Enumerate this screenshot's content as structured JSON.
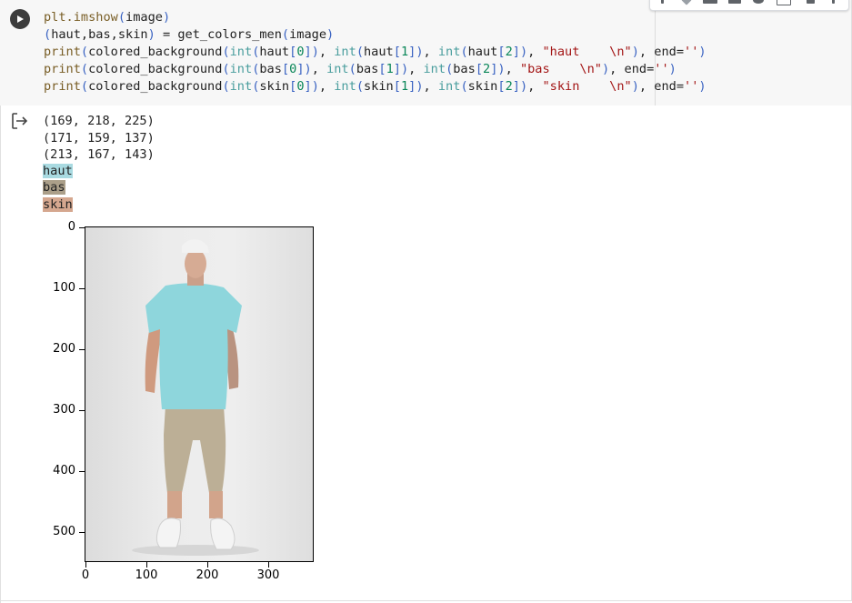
{
  "cell": {
    "code_lines": [
      [
        {
          "t": "plt.imshow",
          "c": "fn"
        },
        {
          "t": "(",
          "c": "pp"
        },
        {
          "t": "image",
          "c": ""
        },
        {
          "t": ")",
          "c": "pp"
        }
      ],
      [
        {
          "t": "(",
          "c": "pp"
        },
        {
          "t": "haut,bas,skin",
          "c": ""
        },
        {
          "t": ")",
          "c": "pp"
        },
        {
          "t": " = get_colors_men",
          "c": ""
        },
        {
          "t": "(",
          "c": "pp"
        },
        {
          "t": "image",
          "c": ""
        },
        {
          "t": ")",
          "c": "pp"
        }
      ],
      [
        {
          "t": "print",
          "c": "fn"
        },
        {
          "t": "(",
          "c": "pp"
        },
        {
          "t": "colored_background",
          "c": ""
        },
        {
          "t": "(",
          "c": "pp"
        },
        {
          "t": "int",
          "c": "bi"
        },
        {
          "t": "(",
          "c": "pp"
        },
        {
          "t": "haut",
          "c": ""
        },
        {
          "t": "[",
          "c": "pp"
        },
        {
          "t": "0",
          "c": "num"
        },
        {
          "t": "]",
          "c": "pp"
        },
        {
          "t": ")",
          "c": "pp"
        },
        {
          "t": ", ",
          "c": ""
        },
        {
          "t": "int",
          "c": "bi"
        },
        {
          "t": "(",
          "c": "pp"
        },
        {
          "t": "haut",
          "c": ""
        },
        {
          "t": "[",
          "c": "pp"
        },
        {
          "t": "1",
          "c": "num"
        },
        {
          "t": "]",
          "c": "pp"
        },
        {
          "t": ")",
          "c": "pp"
        },
        {
          "t": ", ",
          "c": ""
        },
        {
          "t": "int",
          "c": "bi"
        },
        {
          "t": "(",
          "c": "pp"
        },
        {
          "t": "haut",
          "c": ""
        },
        {
          "t": "[",
          "c": "pp"
        },
        {
          "t": "2",
          "c": "num"
        },
        {
          "t": "]",
          "c": "pp"
        },
        {
          "t": ")",
          "c": "pp"
        },
        {
          "t": ", ",
          "c": ""
        },
        {
          "t": "\"haut    \\n\"",
          "c": "str"
        },
        {
          "t": ")",
          "c": "pp"
        },
        {
          "t": ", end=",
          "c": ""
        },
        {
          "t": "''",
          "c": "str"
        },
        {
          "t": ")",
          "c": "pp"
        }
      ],
      [
        {
          "t": "print",
          "c": "fn"
        },
        {
          "t": "(",
          "c": "pp"
        },
        {
          "t": "colored_background",
          "c": ""
        },
        {
          "t": "(",
          "c": "pp"
        },
        {
          "t": "int",
          "c": "bi"
        },
        {
          "t": "(",
          "c": "pp"
        },
        {
          "t": "bas",
          "c": ""
        },
        {
          "t": "[",
          "c": "pp"
        },
        {
          "t": "0",
          "c": "num"
        },
        {
          "t": "]",
          "c": "pp"
        },
        {
          "t": ")",
          "c": "pp"
        },
        {
          "t": ", ",
          "c": ""
        },
        {
          "t": "int",
          "c": "bi"
        },
        {
          "t": "(",
          "c": "pp"
        },
        {
          "t": "bas",
          "c": ""
        },
        {
          "t": "[",
          "c": "pp"
        },
        {
          "t": "1",
          "c": "num"
        },
        {
          "t": "]",
          "c": "pp"
        },
        {
          "t": ")",
          "c": "pp"
        },
        {
          "t": ", ",
          "c": ""
        },
        {
          "t": "int",
          "c": "bi"
        },
        {
          "t": "(",
          "c": "pp"
        },
        {
          "t": "bas",
          "c": ""
        },
        {
          "t": "[",
          "c": "pp"
        },
        {
          "t": "2",
          "c": "num"
        },
        {
          "t": "]",
          "c": "pp"
        },
        {
          "t": ")",
          "c": "pp"
        },
        {
          "t": ", ",
          "c": ""
        },
        {
          "t": "\"bas    \\n\"",
          "c": "str"
        },
        {
          "t": ")",
          "c": "pp"
        },
        {
          "t": ", end=",
          "c": ""
        },
        {
          "t": "''",
          "c": "str"
        },
        {
          "t": ")",
          "c": "pp"
        }
      ],
      [
        {
          "t": "print",
          "c": "fn"
        },
        {
          "t": "(",
          "c": "pp"
        },
        {
          "t": "colored_background",
          "c": ""
        },
        {
          "t": "(",
          "c": "pp"
        },
        {
          "t": "int",
          "c": "bi"
        },
        {
          "t": "(",
          "c": "pp"
        },
        {
          "t": "skin",
          "c": ""
        },
        {
          "t": "[",
          "c": "pp"
        },
        {
          "t": "0",
          "c": "num"
        },
        {
          "t": "]",
          "c": "pp"
        },
        {
          "t": ")",
          "c": "pp"
        },
        {
          "t": ", ",
          "c": ""
        },
        {
          "t": "int",
          "c": "bi"
        },
        {
          "t": "(",
          "c": "pp"
        },
        {
          "t": "skin",
          "c": ""
        },
        {
          "t": "[",
          "c": "pp"
        },
        {
          "t": "1",
          "c": "num"
        },
        {
          "t": "]",
          "c": "pp"
        },
        {
          "t": ")",
          "c": "pp"
        },
        {
          "t": ", ",
          "c": ""
        },
        {
          "t": "int",
          "c": "bi"
        },
        {
          "t": "(",
          "c": "pp"
        },
        {
          "t": "skin",
          "c": ""
        },
        {
          "t": "[",
          "c": "pp"
        },
        {
          "t": "2",
          "c": "num"
        },
        {
          "t": "]",
          "c": "pp"
        },
        {
          "t": ")",
          "c": "pp"
        },
        {
          "t": ", ",
          "c": ""
        },
        {
          "t": "\"skin    \\n\"",
          "c": "str"
        },
        {
          "t": ")",
          "c": "pp"
        },
        {
          "t": ", end=",
          "c": ""
        },
        {
          "t": "''",
          "c": "str"
        },
        {
          "t": ")",
          "c": "pp"
        }
      ]
    ]
  },
  "output": {
    "tuples": [
      "(169, 218, 225)",
      "(171, 159, 137)",
      "(213, 167, 143)"
    ],
    "color_rows": [
      {
        "label": "haut    ",
        "color": "#a9dae1"
      },
      {
        "label": "bas    ",
        "color": "#ab9f89"
      },
      {
        "label": "skin    ",
        "color": "#d5a78f"
      }
    ]
  },
  "plot": {
    "y_ticks": [
      "0",
      "100",
      "200",
      "300",
      "400",
      "500"
    ],
    "x_ticks": [
      "0",
      "100",
      "200",
      "300"
    ]
  },
  "icons": {
    "run": "play-icon",
    "output": "output-redirect-icon"
  }
}
